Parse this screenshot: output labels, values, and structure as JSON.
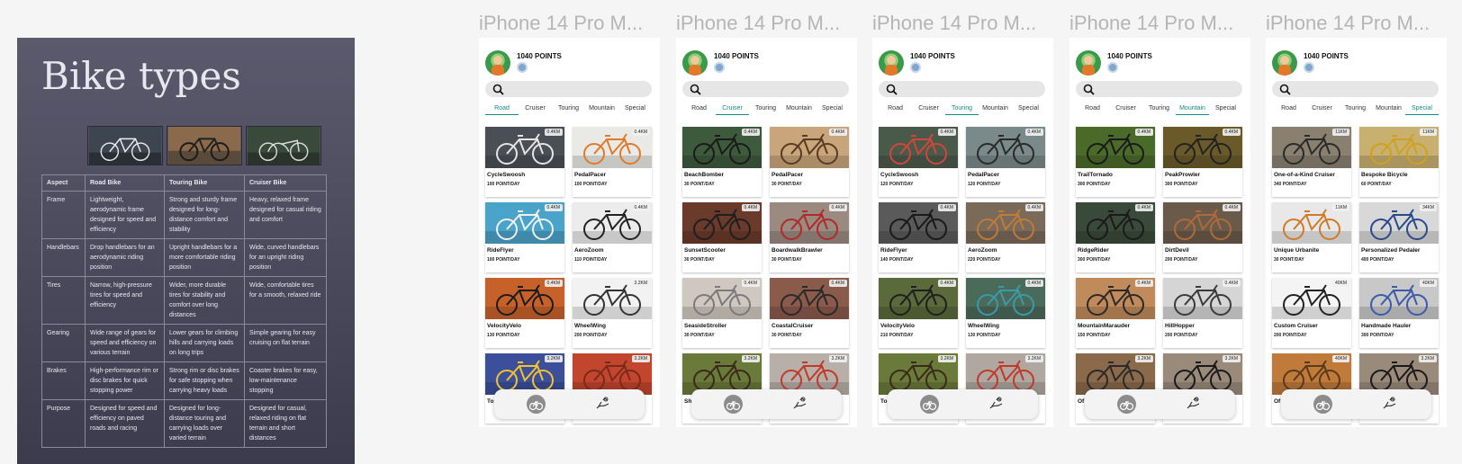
{
  "info_panel": {
    "title": "Bike types",
    "table": {
      "headers": [
        "Aspect",
        "Road Bike",
        "Touring Bike",
        "Cruiser Bike"
      ],
      "rows": [
        [
          "Frame",
          "Lightweight, aerodynamic frame designed for speed and efficiency",
          "Strong and sturdy frame designed for long-distance comfort and stability",
          "Heavy, relaxed frame designed for casual riding and comfort"
        ],
        [
          "Handlebars",
          "Drop handlebars for an aerodynamic riding position",
          "Upright handlebars for a more comfortable riding position",
          "Wide, curved handlebars for an upright riding position"
        ],
        [
          "Tires",
          "Narrow, high-pressure tires for speed and efficiency",
          "Wider, more durable tires for stability and comfort over long distances",
          "Wide, comfortable tires for a smooth, relaxed ride"
        ],
        [
          "Gearing",
          "Wide range of gears for speed and efficiency on various terrain",
          "Lower gears for climbing hills and carrying loads on long trips",
          "Simple gearing for easy cruising on flat terrain"
        ],
        [
          "Brakes",
          "High-performance rim or disc brakes for quick stopping power",
          "Strong rim or disc brakes for safe stopping when carrying heavy loads",
          "Coaster brakes for easy, low-maintenance stopping"
        ],
        [
          "Purpose",
          "Designed for speed and efficiency on paved roads and racing",
          "Designed for long-distance touring and carrying loads over varied terrain",
          "Designed for casual, relaxed riding on flat terrain and short distances"
        ]
      ]
    }
  },
  "colors": {
    "accent": "#0f8a84",
    "panel_bg": "#4a4959",
    "page_bg": "#f5f5f5"
  },
  "frames": [
    {
      "label": "iPhone 14 Pro M...",
      "points": "1040 POINTS",
      "tabs": [
        "Road",
        "Cruiser",
        "Touring",
        "Mountain",
        "Special"
      ],
      "active_tab": "Road",
      "cards": [
        {
          "name": "CycleSwoosh",
          "rate": "100 POINT/DAY",
          "dist": "0.4KM",
          "img": "#4a4f55",
          "frame_color": "#e5e5e5"
        },
        {
          "name": "PedalPacer",
          "rate": "100 POINT/DAY",
          "dist": "0.4KM",
          "img": "#e9e9e6",
          "frame_color": "#e07a2a"
        },
        {
          "name": "RideFlyer",
          "rate": "100 POINT/DAY",
          "dist": "0.4KM",
          "img": "#4aa3c8",
          "frame_color": "#f0f0f0"
        },
        {
          "name": "AeroZoom",
          "rate": "110 POINT/DAY",
          "dist": "0.4KM",
          "img": "#ececec",
          "frame_color": "#222222"
        },
        {
          "name": "VelocityVelo",
          "rate": "130 POINT/DAY",
          "dist": "0.4KM",
          "img": "#c7612a",
          "frame_color": "#1c1c1c"
        },
        {
          "name": "WheelWing",
          "rate": "200 POINT/DAY",
          "dist": "3.2KM",
          "img": "#f2f2f2",
          "frame_color": "#333333"
        },
        {
          "name": "To",
          "rate": "",
          "dist": "3.2KM",
          "img": "#3b4f9a",
          "frame_color": "#f2c230"
        },
        {
          "name": "",
          "rate": "",
          "dist": "3.2KM",
          "img": "#c2452e",
          "frame_color": "#7a2a1a"
        }
      ]
    },
    {
      "label": "iPhone 14 Pro M...",
      "points": "1040 POINTS",
      "tabs": [
        "Road",
        "Cruiser",
        "Touring",
        "Mountain",
        "Special"
      ],
      "active_tab": "Cruiser",
      "cards": [
        {
          "name": "BeachBomber",
          "rate": "30 POINT/DAY",
          "dist": "0.4KM",
          "img": "#3e5a3c",
          "frame_color": "#1a1a1a"
        },
        {
          "name": "PedalPacer",
          "rate": "30 POINT/DAY",
          "dist": "0.4KM",
          "img": "#c9a57c",
          "frame_color": "#5a3a22"
        },
        {
          "name": "SunsetScooter",
          "rate": "30 POINT/DAY",
          "dist": "0.4KM",
          "img": "#6a3a2a",
          "frame_color": "#1f1f1f"
        },
        {
          "name": "BoardwalkBrawler",
          "rate": "30 POINT/DAY",
          "dist": "0.4KM",
          "img": "#9a8a80",
          "frame_color": "#b02a2a"
        },
        {
          "name": "SeasideStroller",
          "rate": "30 POINT/DAY",
          "dist": "0.4KM",
          "img": "#cfc8c0",
          "frame_color": "#7a7a7a"
        },
        {
          "name": "CoastalCruiser",
          "rate": "30 POINT/DAY",
          "dist": "0.4KM",
          "img": "#8a5a4a",
          "frame_color": "#2a2a2a"
        },
        {
          "name": "Sh",
          "rate": "",
          "dist": "3.2KM",
          "img": "#6a7a3a",
          "frame_color": "#3a2a1a"
        },
        {
          "name": "",
          "rate": "",
          "dist": "3.2KM",
          "img": "#b8b0a8",
          "frame_color": "#c0392b"
        }
      ]
    },
    {
      "label": "iPhone 14 Pro M...",
      "points": "1040 POINTS",
      "tabs": [
        "Road",
        "Cruiser",
        "Touring",
        "Mountain",
        "Special"
      ],
      "active_tab": "Touring",
      "cards": [
        {
          "name": "CycleSwoosh",
          "rate": "120 POINT/DAY",
          "dist": "0.4KM",
          "img": "#4a5a4a",
          "frame_color": "#d0463a"
        },
        {
          "name": "PedalPacer",
          "rate": "120 POINT/DAY",
          "dist": "0.4KM",
          "img": "#7a8a8a",
          "frame_color": "#2a2a2a"
        },
        {
          "name": "RideFlyer",
          "rate": "140 POINT/DAY",
          "dist": "0.4KM",
          "img": "#5a5a5a",
          "frame_color": "#1a1a1a"
        },
        {
          "name": "AeroZoom",
          "rate": "220 POINT/DAY",
          "dist": "0.4KM",
          "img": "#7a6a5a",
          "frame_color": "#c07a3a"
        },
        {
          "name": "VelocityVelo",
          "rate": "210 POINT/DAY",
          "dist": "0.4KM",
          "img": "#5a6a3a",
          "frame_color": "#1f1f1f"
        },
        {
          "name": "WheelWing",
          "rate": "130 POINT/DAY",
          "dist": "0.4KM",
          "img": "#4a6a5a",
          "frame_color": "#3a9aaa"
        },
        {
          "name": "To",
          "rate": "",
          "dist": "3.2KM",
          "img": "#6a7a3a",
          "frame_color": "#3a2a1a"
        },
        {
          "name": "",
          "rate": "",
          "dist": "3.2KM",
          "img": "#b0a8a0",
          "frame_color": "#c0392b"
        }
      ]
    },
    {
      "label": "iPhone 14 Pro M...",
      "points": "1040 POINTS",
      "tabs": [
        "Road",
        "Cruiser",
        "Touring",
        "Mountain",
        "Special"
      ],
      "active_tab": "Mountain",
      "cards": [
        {
          "name": "TrailTornado",
          "rate": "300 POINT/DAY",
          "dist": "0.4KM",
          "img": "#4a6a2a",
          "frame_color": "#1a1a1a"
        },
        {
          "name": "PeakProwler",
          "rate": "300 POINT/DAY",
          "dist": "0.4KM",
          "img": "#6a5a2a",
          "frame_color": "#222222"
        },
        {
          "name": "RidgeRider",
          "rate": "300 POINT/DAY",
          "dist": "0.4KM",
          "img": "#3a4a3a",
          "frame_color": "#1a1a1a"
        },
        {
          "name": "DirtDevil",
          "rate": "200 POINT/DAY",
          "dist": "0.4KM",
          "img": "#6a5a4a",
          "frame_color": "#b06a3a"
        },
        {
          "name": "MountainMarauder",
          "rate": "150 POINT/DAY",
          "dist": "0.4KM",
          "img": "#c08a5a",
          "frame_color": "#2a2a2a"
        },
        {
          "name": "HillHopper",
          "rate": "200 POINT/DAY",
          "dist": "0.4KM",
          "img": "#d5d5d5",
          "frame_color": "#3a3a3a"
        },
        {
          "name": "Of",
          "rate": "",
          "dist": "3.2KM",
          "img": "#8a6a4a",
          "frame_color": "#2a2a2a"
        },
        {
          "name": "",
          "rate": "",
          "dist": "3.2KM",
          "img": "#9a8a7a",
          "frame_color": "#1a1a1a"
        }
      ]
    },
    {
      "label": "iPhone 14 Pro M...",
      "points": "1040 POINTS",
      "tabs": [
        "Road",
        "Cruiser",
        "Touring",
        "Mountain",
        "Special"
      ],
      "active_tab": "Special",
      "cards": [
        {
          "name": "One-of-a-Kind Cruiser",
          "rate": "340 POINT/DAY",
          "dist": "11KM",
          "img": "#8a8070",
          "frame_color": "#2a2a2a"
        },
        {
          "name": "Bespoke Bicycle",
          "rate": "60 POINT/DAY",
          "dist": "11KM",
          "img": "#c8b070",
          "frame_color": "#d0a020"
        },
        {
          "name": "Unique Urbanite",
          "rate": "30 POINT/DAY",
          "dist": "11KM",
          "img": "#e8e8e8",
          "frame_color": "#d07a2a"
        },
        {
          "name": "Personalized Pedaler",
          "rate": "400 POINT/DAY",
          "dist": "34KM",
          "img": "#d8d8d8",
          "frame_color": "#2a4a8a"
        },
        {
          "name": "Custom Cruiser",
          "rate": "200 POINT/DAY",
          "dist": "40KM",
          "img": "#f4f4f4",
          "frame_color": "#222222"
        },
        {
          "name": "Handmade Hauler",
          "rate": "300 POINT/DAY",
          "dist": "40KM",
          "img": "#c8c8c8",
          "frame_color": "#3a5aaa"
        },
        {
          "name": "Of",
          "rate": "",
          "dist": "40KM",
          "img": "#c07a3a",
          "frame_color": "#5a3a1a"
        },
        {
          "name": "",
          "rate": "",
          "dist": "3.2KM",
          "img": "#9a8a7a",
          "frame_color": "#1a1a1a"
        }
      ]
    }
  ]
}
